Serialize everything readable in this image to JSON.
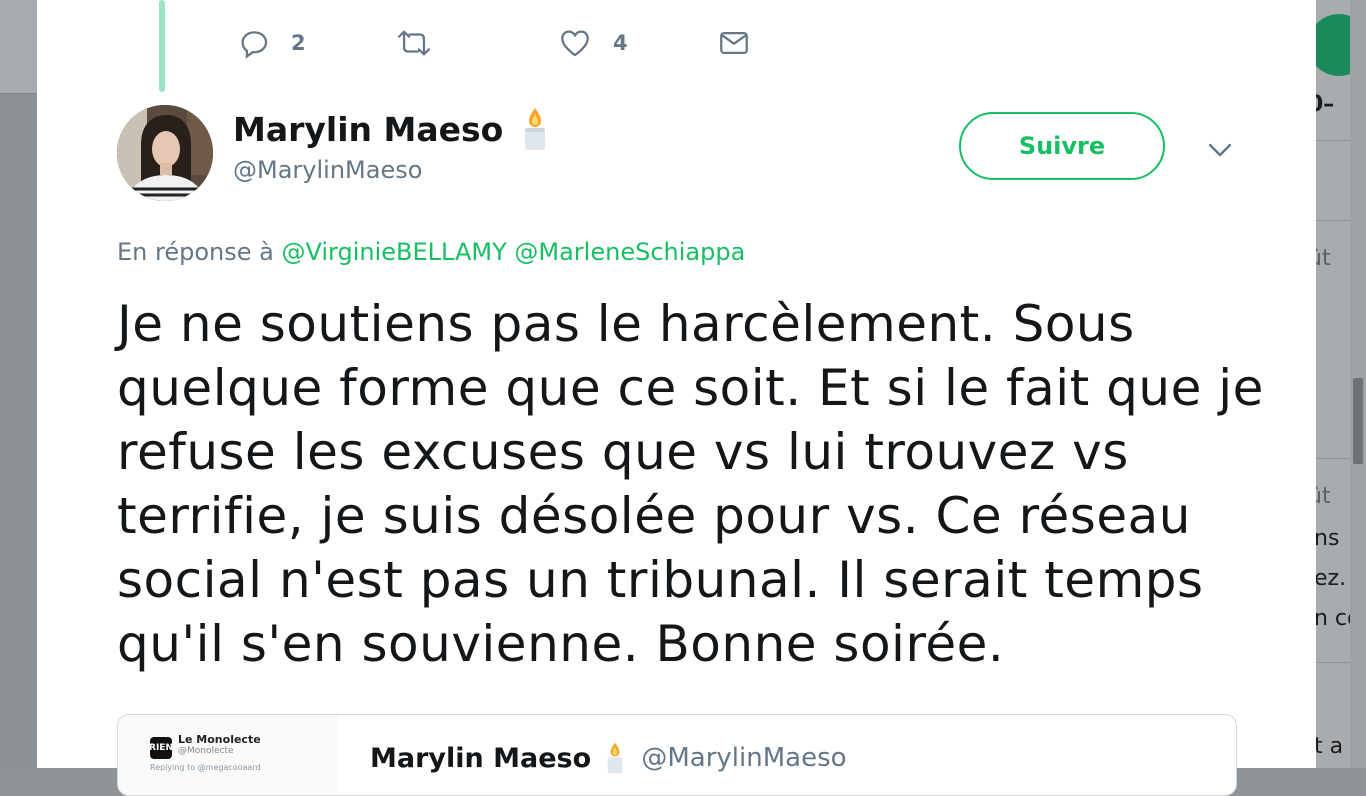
{
  "background_page": {
    "right_fragments": [
      "0–",
      "ût",
      "ût",
      "ns",
      "ez.",
      "n co",
      "t a"
    ]
  },
  "actions": {
    "reply_count": "2",
    "retweet_count": "",
    "like_count": "4"
  },
  "tweet": {
    "display_name": "Marylin Maeso",
    "handle": "@MarylinMaeso",
    "follow_label": "Suivre",
    "reply_prefix": "En réponse à",
    "reply_mentions": [
      "@VirginieBELLAMY",
      "@MarleneSchiappa"
    ],
    "text_lines": [
      "Je ne soutiens pas le harcèlement. Sous",
      "quelque forme que ce soit. Et si le fait que je",
      "refuse les excuses que vs lui trouvez vs",
      "terrifie, je suis désolée pour vs. Ce réseau",
      "social n'est pas un tribunal. Il serait temps",
      "qu'il s'en souvienne. Bonne soirée."
    ]
  },
  "quote": {
    "thumb_title": "Le Monolecte",
    "thumb_handle": "@Monolecte",
    "thumb_reply": "Replying to @megacooaard",
    "display_name": "Marylin Maeso",
    "handle": "@MarylinMaeso"
  },
  "colors": {
    "accent": "#17bf63",
    "thread_line": "#9be3c2",
    "secondary_text": "#657786",
    "primary_text": "#14171a"
  }
}
